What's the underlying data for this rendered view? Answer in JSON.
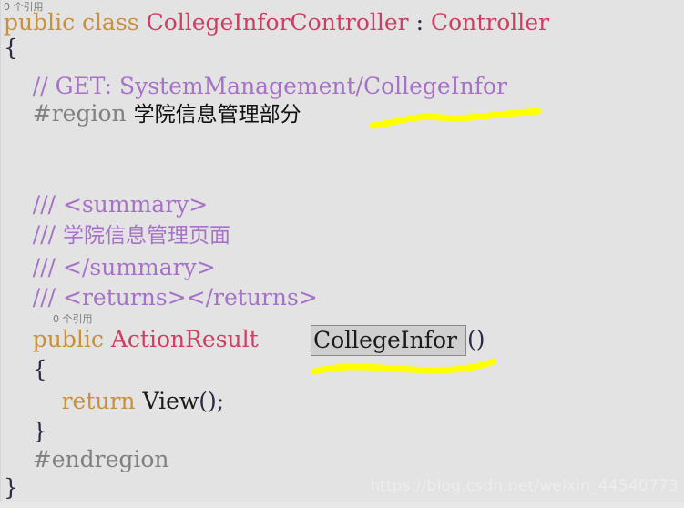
{
  "editor": {
    "background_color": "#e3e3e3",
    "language": "C#",
    "codelens": {
      "class_reference_count": "0 个引用",
      "method_reference_count": "0 个引用"
    },
    "selection": {
      "text": "CollegeInfor",
      "fill_color": "#cfcfcf",
      "border_color": "#8a8a8a"
    },
    "colors": {
      "keyword": "#c9903b",
      "type_name": "#cc3f63",
      "comment": "#a672c8",
      "preprocessor": "#808080",
      "plain_text": "#1b1b1b",
      "punctuation": "#2b2b45",
      "highlighter": "#ffff00"
    },
    "lines": [
      {
        "id": "line-class-decl",
        "tokens": [
          {
            "text": "public class ",
            "kind": "kw"
          },
          {
            "text": "CollegeInforController",
            "kind": "type"
          },
          {
            "text": " : ",
            "kind": "punc"
          },
          {
            "text": "Controller",
            "kind": "type"
          }
        ]
      },
      {
        "id": "line-class-open-brace",
        "tokens": [
          {
            "text": "{",
            "kind": "punc"
          }
        ]
      },
      {
        "id": "line-get-comment",
        "tokens": [
          {
            "text": "    // GET: SystemManagement/CollegeInfor",
            "kind": "cmt"
          }
        ]
      },
      {
        "id": "line-region",
        "tokens": [
          {
            "text": "    #region ",
            "kind": "pre"
          },
          {
            "text": "学院信息管理部分",
            "kind": "cjk"
          }
        ]
      },
      {
        "id": "line-summary-open",
        "tokens": [
          {
            "text": "    /// <summary>",
            "kind": "cmt"
          }
        ]
      },
      {
        "id": "line-summary-body",
        "tokens": [
          {
            "text": "    /// ",
            "kind": "cmt"
          },
          {
            "text": "学院信息管理页面",
            "kind": "cmt-cjk"
          }
        ]
      },
      {
        "id": "line-summary-close",
        "tokens": [
          {
            "text": "    /// </summary>",
            "kind": "cmt"
          }
        ]
      },
      {
        "id": "line-returns",
        "tokens": [
          {
            "text": "    /// <returns></returns>",
            "kind": "cmt"
          }
        ]
      },
      {
        "id": "line-method-decl",
        "tokens": [
          {
            "text": "    public ",
            "kind": "kw"
          },
          {
            "text": "ActionResult",
            "kind": "type"
          },
          {
            "text": " ",
            "kind": "plain"
          },
          {
            "text": "CollegeInfor",
            "kind": "selected"
          },
          {
            "text": "()",
            "kind": "punc"
          }
        ]
      },
      {
        "id": "line-method-open-brace",
        "tokens": [
          {
            "text": "    {",
            "kind": "punc"
          }
        ]
      },
      {
        "id": "line-return-view",
        "tokens": [
          {
            "text": "        return ",
            "kind": "kw"
          },
          {
            "text": "View",
            "kind": "plain"
          },
          {
            "text": "();",
            "kind": "punc"
          }
        ]
      },
      {
        "id": "line-method-close-brace",
        "tokens": [
          {
            "text": "    }",
            "kind": "punc"
          }
        ]
      },
      {
        "id": "line-endregion",
        "tokens": [
          {
            "text": "    #endregion",
            "kind": "pre"
          }
        ]
      },
      {
        "id": "line-class-close-brace",
        "tokens": [
          {
            "text": "}",
            "kind": "punc"
          }
        ]
      }
    ],
    "annotations": [
      {
        "id": "highlighter-stroke-region",
        "color": "#ffff00"
      },
      {
        "id": "highlighter-stroke-method",
        "color": "#ffff00"
      }
    ]
  },
  "watermark": {
    "text": "https://blog.csdn.net/weixin_44540773"
  },
  "text": {
    "line_class_decl_kw": "public class ",
    "line_class_decl_type": "CollegeInforController",
    "line_class_decl_colon": " : ",
    "line_class_decl_base": "Controller",
    "line_class_open_brace": "{",
    "line_get_comment": "    // GET: SystemManagement/CollegeInfor",
    "line_region_kw": "    #region ",
    "line_region_cjk": "学院信息管理部分",
    "line_summary_open": "    /// <summary>",
    "line_summary_slashes": "    /// ",
    "line_summary_cjk": "学院信息管理页面",
    "line_summary_close": "    /// </summary>",
    "line_returns": "    /// <returns></returns>",
    "line_method_kw": "    public ",
    "line_method_type": "ActionResult",
    "line_method_parens": "()",
    "line_method_name": "CollegeInfor",
    "line_method_open_brace": "    {",
    "line_return_kw": "        return ",
    "line_return_view": "View",
    "line_return_punc": "();",
    "line_method_close_brace": "    }",
    "line_endregion": "    #endregion",
    "line_class_close_brace": "}"
  }
}
